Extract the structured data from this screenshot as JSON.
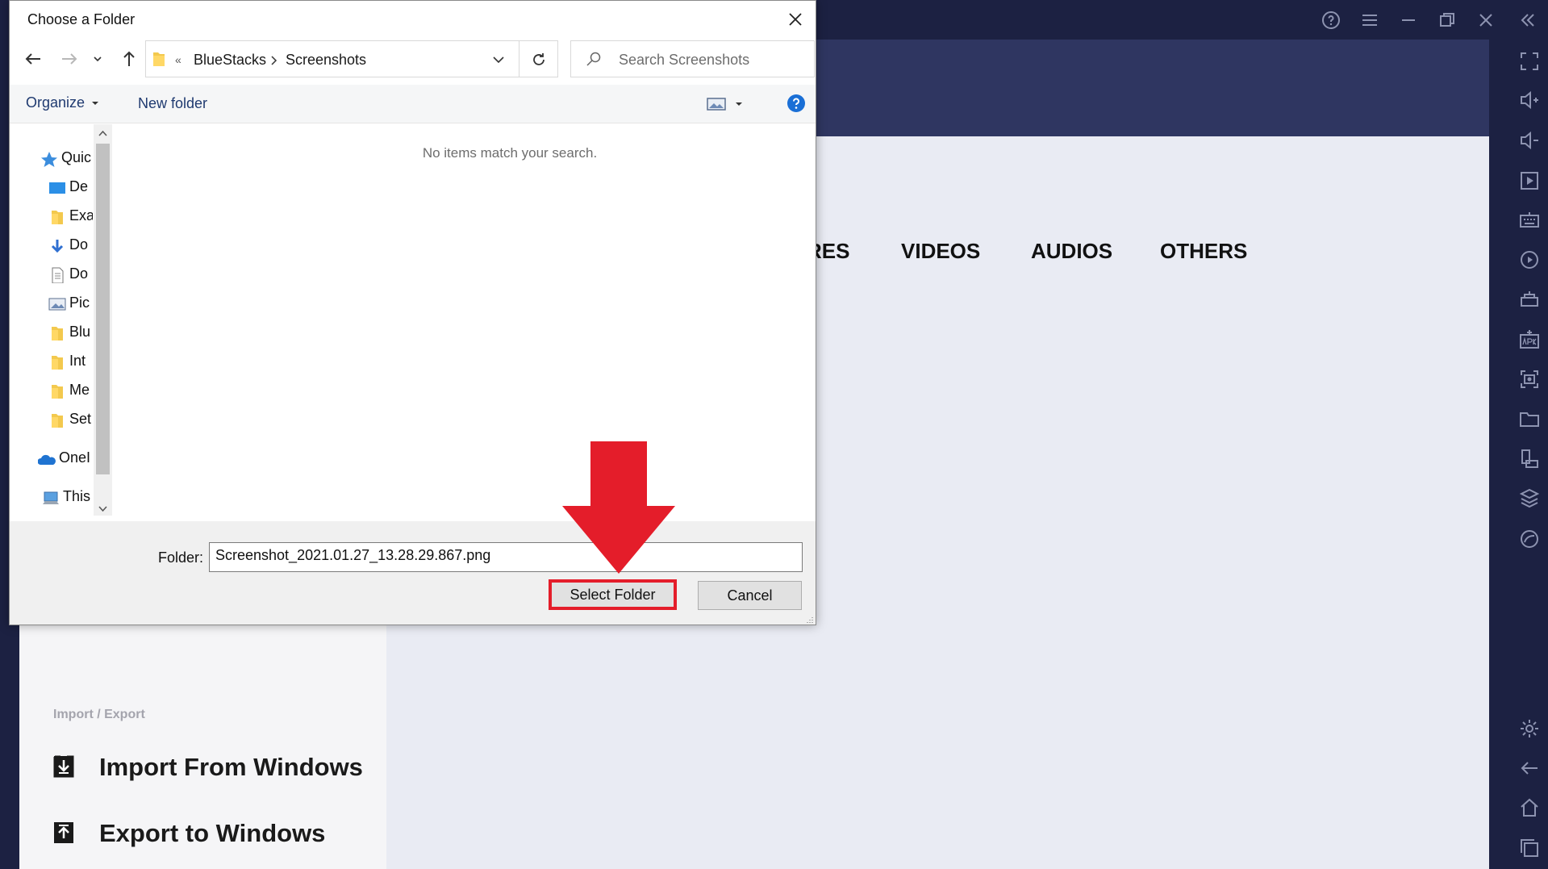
{
  "dialog": {
    "title": "Choose a Folder",
    "breadcrumb_overflow": "«",
    "breadcrumb": [
      "BlueStacks",
      "Screenshots"
    ],
    "search_placeholder": "Search Screenshots",
    "organize_label": "Organize",
    "new_folder_label": "New folder",
    "empty_message": "No items match your search.",
    "nav_items": [
      {
        "label": "Quic",
        "icon": "star-icon"
      },
      {
        "label": "De",
        "icon": "desktop-icon"
      },
      {
        "label": "Exa",
        "icon": "folder-icon"
      },
      {
        "label": "Do",
        "icon": "download-icon"
      },
      {
        "label": "Do",
        "icon": "document-icon"
      },
      {
        "label": "Pic",
        "icon": "pictures-icon"
      },
      {
        "label": "Blu",
        "icon": "folder-icon"
      },
      {
        "label": "Int",
        "icon": "folder-icon"
      },
      {
        "label": "Me",
        "icon": "folder-icon"
      },
      {
        "label": "Set",
        "icon": "folder-icon"
      },
      {
        "label": "OneI",
        "icon": "onedrive-icon"
      },
      {
        "label": "This",
        "icon": "computer-icon"
      }
    ],
    "folder_label": "Folder:",
    "folder_value": "Screenshot_2021.01.27_13.28.29.867.png",
    "select_button": "Select Folder",
    "cancel_button": "Cancel"
  },
  "bluestacks": {
    "tabs": [
      "RES",
      "VIDEOS",
      "AUDIOS",
      "OTHERS"
    ],
    "section_label": "Import / Export",
    "import_label": "Import From Windows",
    "export_label": "Export to Windows"
  },
  "colors": {
    "titlebar": "#1c2142",
    "header": "#2f3661",
    "content_bg": "#e9ebf3",
    "highlight_red": "#e41d2a",
    "help_blue": "#1a6fd6"
  }
}
